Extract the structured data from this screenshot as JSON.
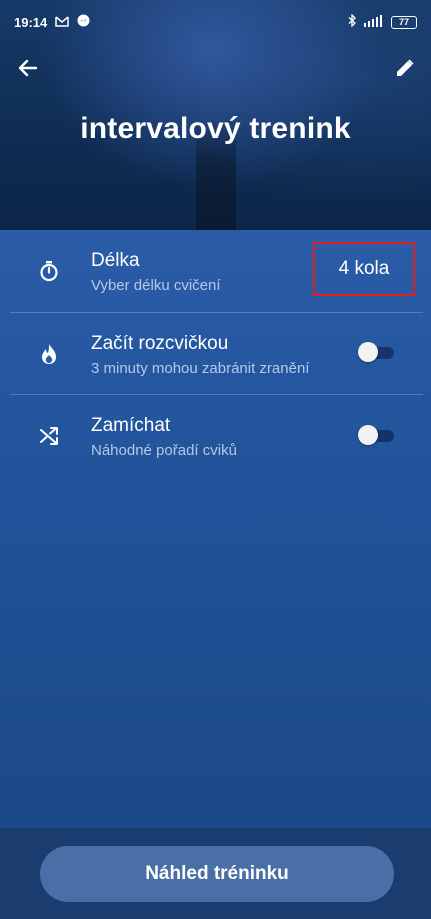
{
  "status_bar": {
    "time": "19:14",
    "battery": "77",
    "left_icons": [
      "gmail-icon",
      "messenger-icon"
    ],
    "right_icons": [
      "bluetooth-icon",
      "signal-icon"
    ]
  },
  "header": {
    "title": "intervalový trenink",
    "back_icon": "arrow-left-icon",
    "edit_icon": "pencil-icon"
  },
  "settings": [
    {
      "icon": "stopwatch-icon",
      "label": "Délka",
      "sub": "Vyber délku cvičení",
      "value": "4 kola"
    },
    {
      "icon": "flame-icon",
      "label": "Začít rozcvičkou",
      "sub": "3 minuty mohou zabránit zranění",
      "toggle": false
    },
    {
      "icon": "shuffle-icon",
      "label": "Zamíchat",
      "sub": "Náhodné pořadí cviků",
      "toggle": false
    }
  ],
  "footer": {
    "button_label": "Náhled tréninku"
  },
  "colors": {
    "highlight": "#e0201e",
    "content_bg": "#2a5ca8",
    "button_bg": "#4a6fa6"
  }
}
